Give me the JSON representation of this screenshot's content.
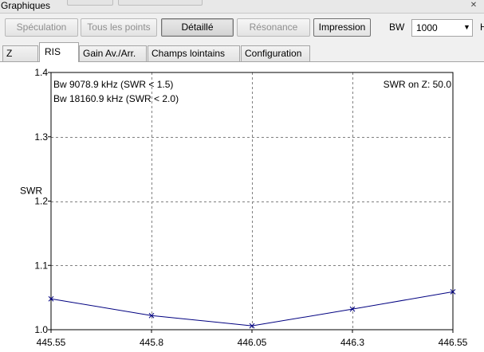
{
  "window": {
    "title": "Graphiques",
    "close_glyph": "✕"
  },
  "toolbar": {
    "buttons": [
      {
        "label": "Spéculation",
        "state": "disabled"
      },
      {
        "label": "Tous les points",
        "state": "disabled"
      },
      {
        "label": "Détaillé",
        "state": "active"
      },
      {
        "label": "Résonance",
        "state": "disabled"
      },
      {
        "label": "Impression",
        "state": "enabled"
      }
    ],
    "bw_label": "BW",
    "bw_value": "1000",
    "bw_unit_clipped": "H"
  },
  "tabs": [
    {
      "label": "Z",
      "active": false
    },
    {
      "label": "RIS",
      "active": true
    },
    {
      "label": "Gain Av./Arr.",
      "active": false
    },
    {
      "label": "Champs lointains",
      "active": false
    },
    {
      "label": "Configuration",
      "active": false
    }
  ],
  "annotations": {
    "bw1": "Bw 9078.9 kHz (SWR < 1.5)",
    "bw2": "Bw 18160.9 kHz (SWR < 2.0)",
    "swr_on_z": "SWR on Z: 50.0"
  },
  "chart_data": {
    "type": "line",
    "ylabel": "SWR",
    "xlabel": "",
    "x": [
      445.55,
      445.8,
      446.05,
      446.3,
      446.55
    ],
    "xticks": [
      "445.55",
      "445.8",
      "446.05",
      "446.3",
      "446.55"
    ],
    "yticks": [
      "1.0",
      "1.1",
      "1.2",
      "1.3",
      "1.4"
    ],
    "xlim": [
      445.55,
      446.55
    ],
    "ylim": [
      1.0,
      1.4
    ],
    "grid": true,
    "series": [
      {
        "values": [
          1.048,
          1.022,
          1.006,
          1.032,
          1.059
        ],
        "color": "#000080"
      }
    ]
  },
  "colors": {
    "series": "#000080",
    "ylabel": "#000080",
    "grid": "#808080"
  }
}
